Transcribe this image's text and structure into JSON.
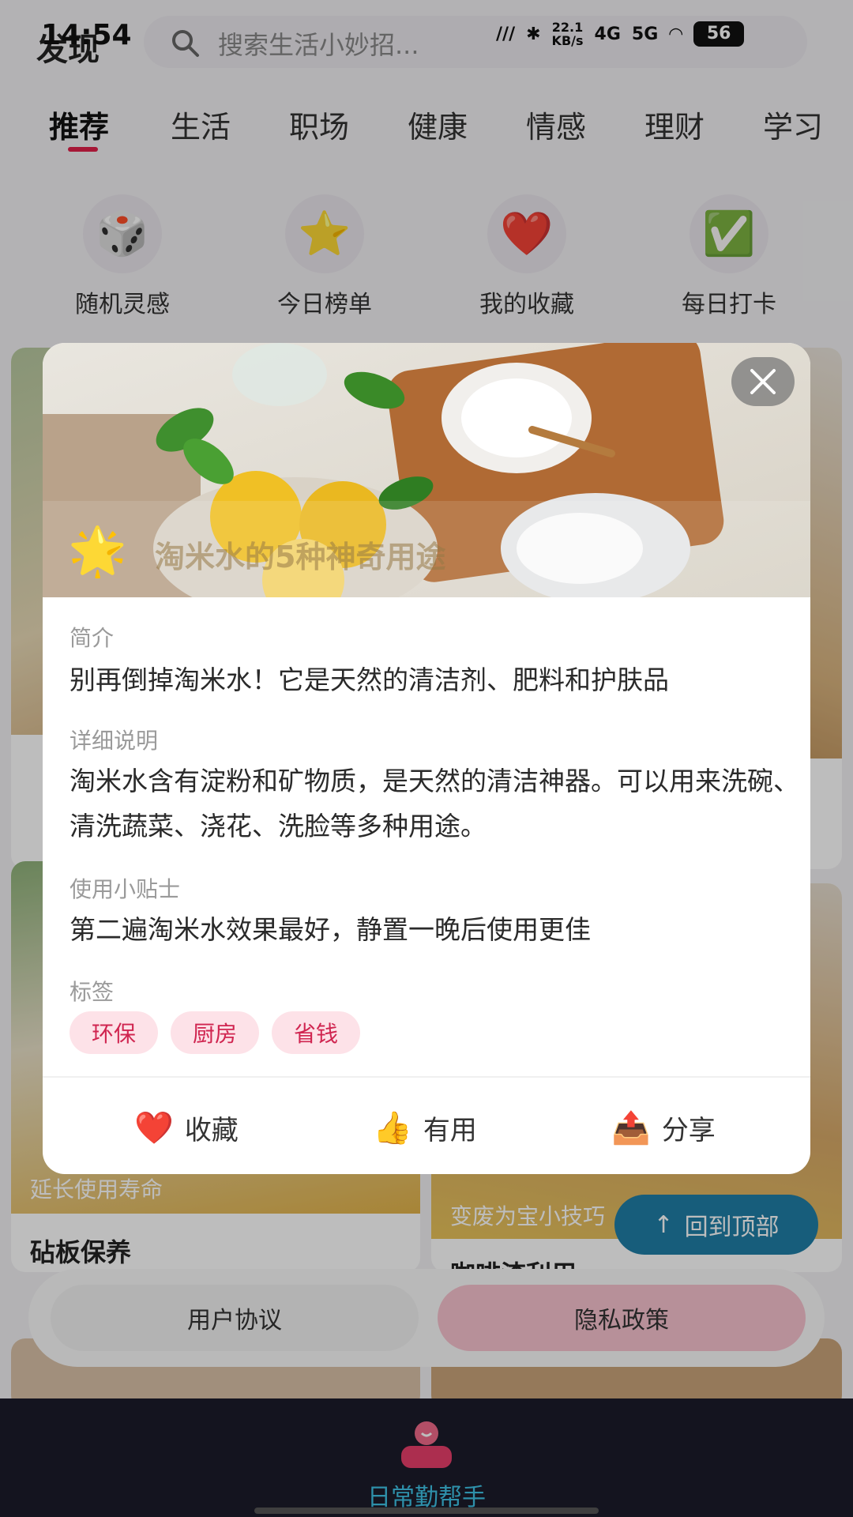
{
  "status": {
    "time": "14:54",
    "net_speed": "22.1",
    "net_unit": "KB/s",
    "net_4g": "4G",
    "net_5g": "5G",
    "battery": "56"
  },
  "header": {
    "title": "发现",
    "search_placeholder": "搜索生活小妙招..."
  },
  "tabs": [
    "推荐",
    "生活",
    "职场",
    "健康",
    "情感",
    "理财",
    "学习"
  ],
  "quick_actions": [
    {
      "icon": "🎲",
      "label": "随机灵感"
    },
    {
      "icon": "⭐",
      "label": "今日榜单"
    },
    {
      "icon": "❤️",
      "label": "我的收藏"
    },
    {
      "icon": "✅",
      "label": "每日打卡"
    }
  ],
  "feed": {
    "card_left_caption": "延长使用寿命",
    "card_left_title": "砧板保养",
    "card_right_caption": "变废为宝小技巧",
    "card_right_title": "咖啡渣利用"
  },
  "back_to_top": "回到顶部",
  "agreement": {
    "user": "用户协议",
    "privacy": "隐私政策"
  },
  "bottom_nav": {
    "app_name": "日常勤帮手"
  },
  "modal": {
    "star_icon": "🌟",
    "title": "淘米水的5种神奇用途",
    "intro_label": "简介",
    "intro": "别再倒掉淘米水！它是天然的清洁剂、肥料和护肤品",
    "detail_label": "详细说明",
    "detail": "淘米水含有淀粉和矿物质，是天然的清洁神器。可以用来洗碗、清洗蔬菜、浇花、洗脸等多种用途。",
    "tips_label": "使用小贴士",
    "tips": "第二遍淘米水效果最好，静置一晚后使用更佳",
    "tags_label": "标签",
    "tags": [
      "环保",
      "厨房",
      "省钱"
    ],
    "actions": [
      {
        "icon": "❤️",
        "label": "收藏"
      },
      {
        "icon": "👍",
        "label": "有用"
      },
      {
        "icon": "📤",
        "label": "分享"
      }
    ]
  },
  "colors": {
    "accent": "#e0204a",
    "tag_bg": "#fde2e8",
    "tag_text": "#d02550",
    "nav_bg": "#1b1b2a",
    "app_name": "#3ec3e6",
    "back_to_top": "#1f7ea6"
  }
}
